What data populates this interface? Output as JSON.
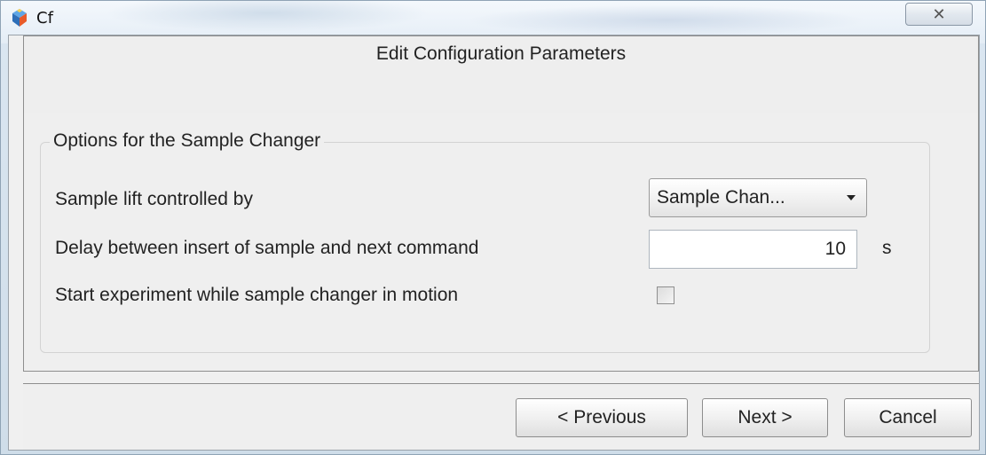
{
  "window": {
    "title": "Cf",
    "close_glyph": "✕",
    "app_icon": "cf-app-icon"
  },
  "header": {
    "title": "Edit Configuration Parameters"
  },
  "group": {
    "legend": "Options for the Sample Changer",
    "rows": [
      {
        "label": "Sample lift controlled by",
        "control": "dropdown",
        "selected": "Sample Chan..."
      },
      {
        "label": "Delay between insert of sample and next command",
        "control": "text-field",
        "value": "10",
        "unit": "s"
      },
      {
        "label": "Start experiment while sample changer in motion",
        "control": "checkbox",
        "checked": false
      }
    ]
  },
  "footer": {
    "previous_label": "< Previous",
    "next_label": "Next >",
    "cancel_label": "Cancel"
  },
  "colors": {
    "window_frame": "#dae6f1",
    "dialog_bg": "#efefef",
    "border": "#8e8e8e"
  }
}
